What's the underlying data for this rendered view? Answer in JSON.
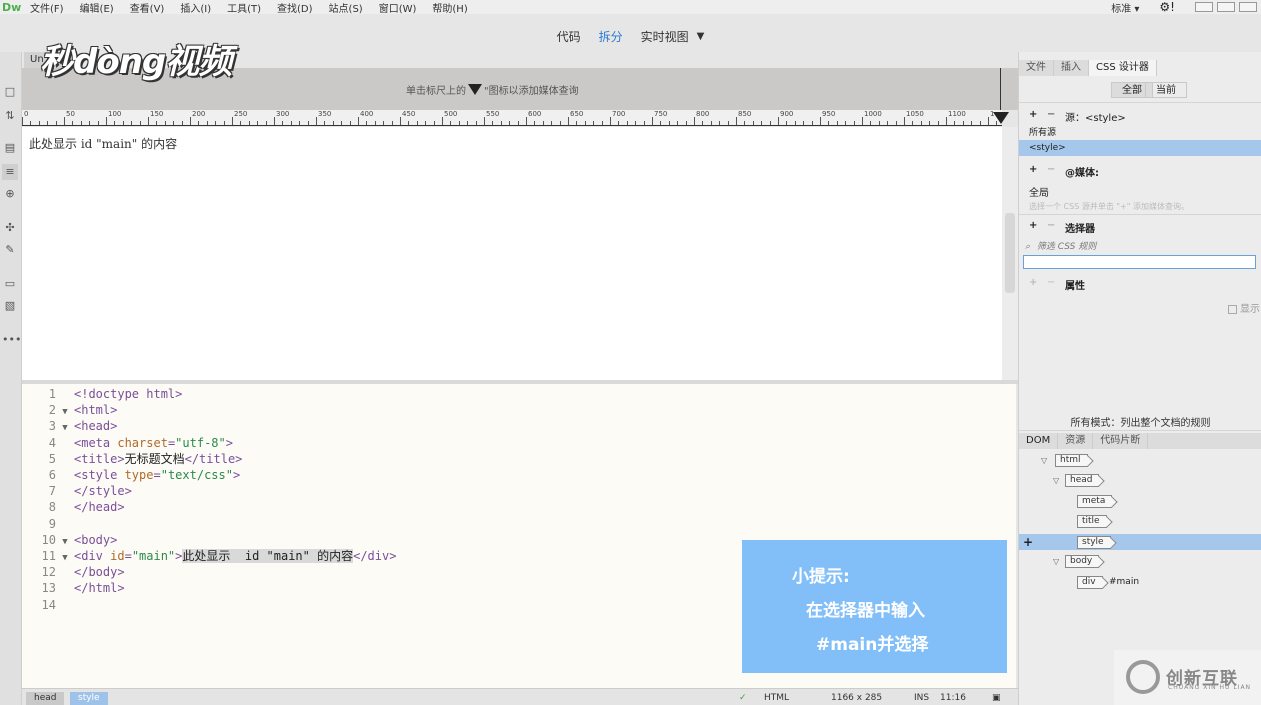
{
  "menubar": {
    "logo": "Dw",
    "items": [
      "文件(F)",
      "编辑(E)",
      "查看(V)",
      "插入(I)",
      "工具(T)",
      "查找(D)",
      "站点(S)",
      "窗口(W)",
      "帮助(H)"
    ],
    "layout": "标准 ▾",
    "gear": "⚙!"
  },
  "viewbar": {
    "code": "代码",
    "split": "拆分",
    "live": "实时视图",
    "caret": "▼"
  },
  "doc_tab": "Un",
  "watermark_logo": "秒dòng视频",
  "media_hint": {
    "before": "单击标尺上的",
    "after": "\"图标以添加媒体查询"
  },
  "ruler_labels": [
    "0",
    "50",
    "100",
    "150",
    "200",
    "250",
    "300",
    "350",
    "400",
    "450",
    "500",
    "550",
    "600",
    "650",
    "700",
    "750",
    "800",
    "850",
    "900",
    "950",
    "1000",
    "1050",
    "1100",
    "1"
  ],
  "live_content": "此处显示 id \"main\" 的内容",
  "code": {
    "lines": [
      {
        "n": "1",
        "fold": "",
        "parts": [
          [
            "tag",
            "<!doctype html>"
          ]
        ]
      },
      {
        "n": "2",
        "fold": "▼",
        "parts": [
          [
            "tag",
            "<html>"
          ]
        ]
      },
      {
        "n": "3",
        "fold": "▼",
        "parts": [
          [
            "tag",
            "<head>"
          ]
        ]
      },
      {
        "n": "4",
        "fold": "",
        "parts": [
          [
            "tag",
            "<meta "
          ],
          [
            "attr",
            "charset"
          ],
          [
            "tag",
            "="
          ],
          [
            "val",
            "\"utf-8\""
          ],
          [
            "tag",
            ">"
          ]
        ]
      },
      {
        "n": "5",
        "fold": "",
        "parts": [
          [
            "tag",
            "<title>"
          ],
          [
            "text",
            "无标题文档"
          ],
          [
            "tag",
            "</title>"
          ]
        ]
      },
      {
        "n": "6",
        "fold": "",
        "parts": [
          [
            "tag",
            "<style "
          ],
          [
            "attr",
            "type"
          ],
          [
            "tag",
            "="
          ],
          [
            "val",
            "\"text/css\""
          ],
          [
            "tag",
            ">"
          ]
        ]
      },
      {
        "n": "7",
        "fold": "",
        "parts": [
          [
            "tag",
            "</style>"
          ]
        ]
      },
      {
        "n": "8",
        "fold": "",
        "parts": [
          [
            "tag",
            "</head>"
          ]
        ]
      },
      {
        "n": "9",
        "fold": "",
        "parts": []
      },
      {
        "n": "10",
        "fold": "▼",
        "parts": [
          [
            "tag",
            "<body>"
          ]
        ]
      },
      {
        "n": "11",
        "fold": "▼",
        "parts": [
          [
            "tag",
            "<div "
          ],
          [
            "attr",
            "id"
          ],
          [
            "tag",
            "="
          ],
          [
            "val",
            "\"main\""
          ],
          [
            "tag",
            ">"
          ],
          [
            "sel",
            "此处显示  id \"main\" 的内容"
          ],
          [
            "tag",
            "</div>"
          ]
        ]
      },
      {
        "n": "12",
        "fold": "",
        "parts": [
          [
            "tag",
            "</body>"
          ]
        ]
      },
      {
        "n": "13",
        "fold": "",
        "parts": [
          [
            "tag",
            "</html>"
          ]
        ]
      },
      {
        "n": "14",
        "fold": "",
        "parts": []
      }
    ]
  },
  "tip": {
    "line1": "小提示:",
    "line2": "在选择器中输入",
    "line3": "#main并选择"
  },
  "statusbar": {
    "crumbs": [
      "head",
      "style"
    ],
    "ok": "✓",
    "lang": "HTML",
    "size": "1166 x 285",
    "ins": "INS",
    "pos": "11:16"
  },
  "right_panel": {
    "tabs": [
      "文件",
      "插入",
      "CSS 设计器"
    ],
    "seg_all": "全部",
    "seg_current": "当前",
    "source_label": "源：<style>",
    "all_sources": "所有源",
    "style_item": "<style>",
    "media_label": "@媒体:",
    "global": "全局",
    "media_hint": "选择一个 CSS 源并单击 \"+\" 添加媒体查询。",
    "selector_label": "选择器",
    "filter_placeholder": "筛选 CSS 规则",
    "props_label": "属性",
    "show_label": "显示",
    "all_modes": "所有模式：列出整个文档的规则"
  },
  "dom_panel": {
    "tabs": [
      "DOM",
      "资源",
      "代码片断"
    ],
    "nodes": {
      "html": "html",
      "head": "head",
      "meta": "meta",
      "title": "title",
      "style": "style",
      "body": "body",
      "div": "div",
      "div_id": "#main"
    }
  },
  "brand_watermark": {
    "name": "创新互联",
    "sub": "CHUANG XIN HU LIAN"
  },
  "colors": {
    "accent": "#2a7bd1",
    "tip_bg": "#82bff8",
    "selected_row": "#a6c7ec"
  }
}
